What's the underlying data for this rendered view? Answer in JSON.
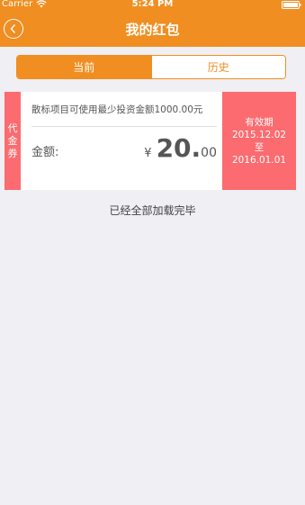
{
  "status_bar": {
    "carrier": "Carrier",
    "time": "5:24 PM"
  },
  "nav": {
    "title": "我的红包"
  },
  "tabs": [
    {
      "label": "当前",
      "active": true
    },
    {
      "label": "历史",
      "active": false
    }
  ],
  "coupon": {
    "type_label_chars": [
      "代",
      "金",
      "券"
    ],
    "description": "散标项目可使用最少投资金额1000.00元",
    "amount_label": "金额:",
    "currency": "¥",
    "amount_int": "20.",
    "amount_dec": "00",
    "validity_label": "有效期",
    "start_date": "2015.12.02",
    "to_label": "至",
    "end_date": "2016.01.01"
  },
  "footer_text": "已经全部加载完毕",
  "colors": {
    "accent": "#f08e21",
    "coupon": "#fb6b70",
    "background": "#efeff4"
  }
}
